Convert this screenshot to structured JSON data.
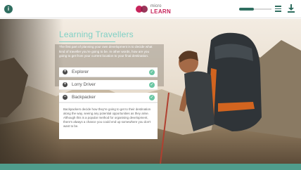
{
  "app": {
    "logo_small": "micro",
    "logo_big": "LEARN"
  },
  "topbar": {
    "info_icon": "info-icon",
    "menu_icon": "hamburger-menu-icon",
    "download_icon": "download-icon",
    "progress": 0.45
  },
  "page": {
    "title": "Learning Travellers",
    "intro": "The first part of planning your own development is to decide what kind of traveller you're going to be. In other words, how are you going to get from your current location to your final destination."
  },
  "accordion": {
    "items": [
      {
        "label": "Explorer",
        "icon": "plus-circle-icon",
        "completed": true
      },
      {
        "label": "Lorry Driver",
        "icon": "plus-circle-icon",
        "completed": true
      },
      {
        "label": "Backpacker",
        "icon": "minus-circle-icon",
        "completed": true
      }
    ],
    "expanded_text": "Backpackers decide how they're going to get to their destination along the way, seeing any potential opportunities as they arise. Although this is a popular method for organising development, there's always a chance you could end up somewhere you don't want to be."
  },
  "colors": {
    "accent": "#2f6e60",
    "title": "#7fd0c4",
    "check": "#6cc7a4",
    "brand": "#c7245b",
    "footer": "#4f9d8c"
  }
}
